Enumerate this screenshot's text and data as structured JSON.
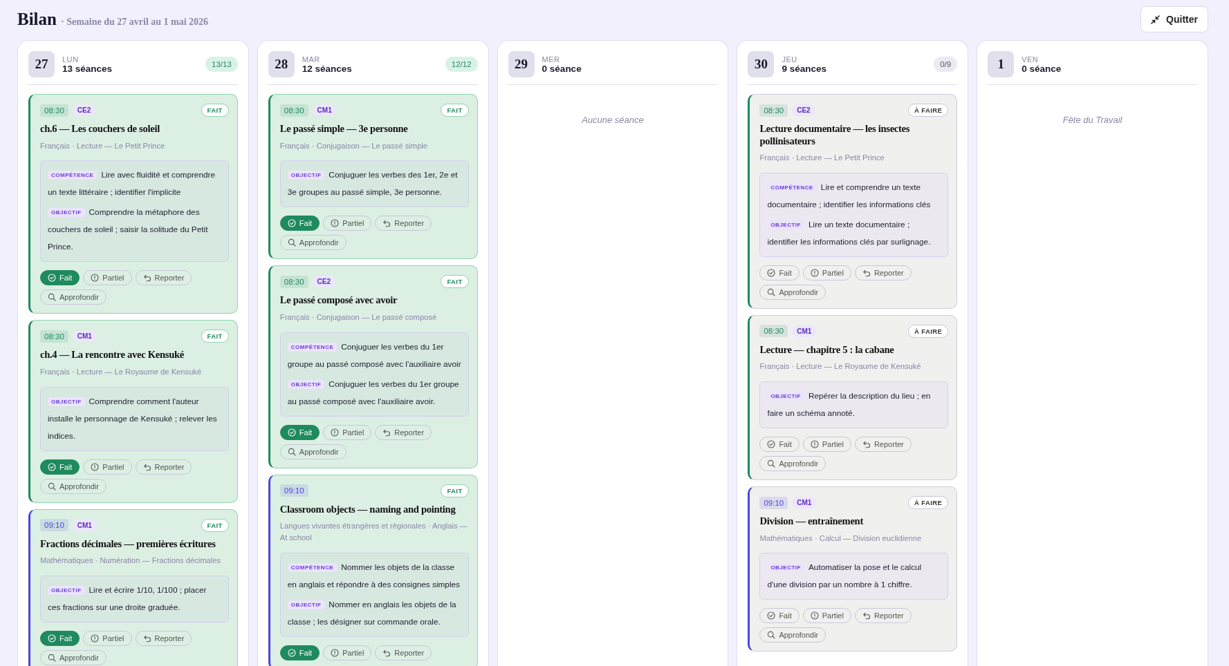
{
  "header": {
    "title": "Bilan",
    "subtitle": "· Semaine du 27 avril au 1 mai 2026",
    "quit_button": "Quitter"
  },
  "days": [
    {
      "day": "27",
      "weekday": "LUN",
      "count": "13 séances",
      "progress": "13/13",
      "sessions": [
        {
          "time": "08:30",
          "level": "CE2",
          "color": "#1f8a5e",
          "status": "FAIT",
          "done": true,
          "title": "ch.6 — Les couchers de soleil",
          "meta": "Français · Lecture — Le Petit Prince",
          "notes": [
            {
              "label": "COMPÉTENCE",
              "text": "Lire avec fluidité et comprendre un texte littéraire ; identifier l'implicite"
            },
            {
              "label": "OBJECTIF",
              "text": "Comprendre la métaphore des couchers de soleil ; saisir la solitude du Petit Prince."
            }
          ],
          "actions": [
            "Fait",
            "Partiel",
            "Reporter",
            "Approfondir"
          ]
        },
        {
          "time": "08:30",
          "level": "CM1",
          "color": "#1f8a5e",
          "status": "FAIT",
          "done": true,
          "title": "ch.4 — La rencontre avec Kensuké",
          "meta": "Français · Lecture — Le Royaume de Kensuké",
          "notes": [
            {
              "label": "OBJECTIF",
              "text": "Comprendre comment l'auteur installe le personnage de Kensuké ; relever les indices."
            }
          ],
          "actions": [
            "Fait",
            "Partiel",
            "Reporter",
            "Approfondir"
          ]
        },
        {
          "time": "09:10",
          "level": "CM1",
          "color": "#4a45e0",
          "status": "FAIT",
          "done": true,
          "title": "Fractions décimales — premières écritures",
          "meta": "Mathématiques · Numération — Fractions décimales",
          "notes": [
            {
              "label": "OBJECTIF",
              "text": "Lire et écrire 1/10, 1/100 ; placer ces fractions sur une droite graduée."
            }
          ],
          "actions": [
            "Fait",
            "Partiel",
            "Reporter",
            "Approfondir"
          ]
        }
      ]
    },
    {
      "day": "28",
      "weekday": "MAR",
      "count": "12 séances",
      "progress": "12/12",
      "sessions": [
        {
          "time": "08:30",
          "level": "CM1",
          "color": "#1f8a5e",
          "status": "FAIT",
          "done": true,
          "title": "Le passé simple — 3e personne",
          "meta": "Français · Conjugaison — Le passé simple",
          "notes": [
            {
              "label": "OBJECTIF",
              "text": "Conjuguer les verbes des 1er, 2e et 3e groupes au passé simple, 3e personne."
            }
          ],
          "actions": [
            "Fait",
            "Partiel",
            "Reporter",
            "Approfondir"
          ]
        },
        {
          "time": "08:30",
          "level": "CE2",
          "color": "#1f8a5e",
          "status": "FAIT",
          "done": true,
          "title": "Le passé composé avec avoir",
          "meta": "Français · Conjugaison — Le passé composé",
          "notes": [
            {
              "label": "COMPÉTENCE",
              "text": "Conjuguer les verbes du 1er groupe au passé composé avec l'auxiliaire avoir"
            },
            {
              "label": "OBJECTIF",
              "text": "Conjuguer les verbes du 1er groupe au passé composé avec l'auxiliaire avoir."
            }
          ],
          "actions": [
            "Fait",
            "Partiel",
            "Reporter",
            "Approfondir"
          ]
        },
        {
          "time": "09:10",
          "color": "#4a45e0",
          "status": "FAIT",
          "done": true,
          "title": "Classroom objects — naming and pointing",
          "meta": "Langues vivantes étrangères et régionales · Anglais — At school",
          "notes": [
            {
              "label": "COMPÉTENCE",
              "text": "Nommer les objets de la classe en anglais et répondre à des consignes simples"
            },
            {
              "label": "OBJECTIF",
              "text": "Nommer en anglais les objets de la classe ; les désigner sur commande orale."
            }
          ],
          "actions": [
            "Fait",
            "Partiel",
            "Reporter"
          ]
        }
      ]
    },
    {
      "day": "29",
      "weekday": "MER",
      "count": "0 séance",
      "empty_message": "Aucune séance"
    },
    {
      "day": "30",
      "weekday": "JEU",
      "count": "9 séances",
      "progress": "0/9",
      "sessions": [
        {
          "time": "08:30",
          "level": "CE2",
          "color": "#1f8a5e",
          "status": "À FAIRE",
          "done": false,
          "title": "Lecture documentaire — les insectes pollinisateurs",
          "meta": "Français · Lecture — Le Petit Prince",
          "notes": [
            {
              "label": "COMPÉTENCE",
              "text": "Lire et comprendre un texte documentaire ; identifier les informations clés"
            },
            {
              "label": "OBJECTIF",
              "text": "Lire un texte documentaire ; identifier les informations clés par surlignage."
            }
          ],
          "actions": [
            "Fait",
            "Partiel",
            "Reporter",
            "Approfondir"
          ]
        },
        {
          "time": "08:30",
          "level": "CM1",
          "color": "#1f8a5e",
          "status": "À FAIRE",
          "done": false,
          "title": "Lecture — chapitre 5 : la cabane",
          "meta": "Français · Lecture — Le Royaume de Kensuké",
          "notes": [
            {
              "label": "OBJECTIF",
              "text": "Repérer la description du lieu ; en faire un schéma annoté."
            }
          ],
          "actions": [
            "Fait",
            "Partiel",
            "Reporter",
            "Approfondir"
          ]
        },
        {
          "time": "09:10",
          "level": "CM1",
          "color": "#4a45e0",
          "status": "À FAIRE",
          "done": false,
          "title": "Division — entraînement",
          "meta": "Mathématiques · Calcul — Division euclidienne",
          "notes": [
            {
              "label": "OBJECTIF",
              "text": "Automatiser la pose et le calcul d'une division par un nombre à 1 chiffre."
            }
          ],
          "actions": [
            "Fait",
            "Partiel",
            "Reporter",
            "Approfondir"
          ]
        }
      ]
    },
    {
      "day": "1",
      "weekday": "VEN",
      "count": "0 séance",
      "empty_message": "Fête du Travail"
    }
  ]
}
